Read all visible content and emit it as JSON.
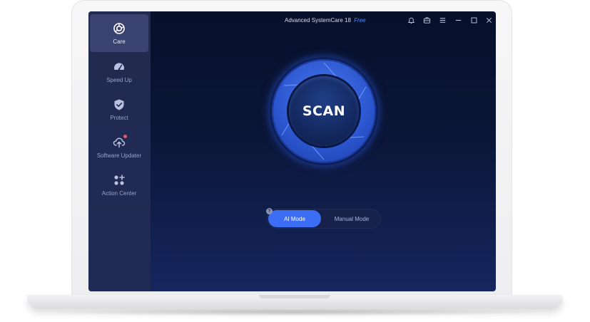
{
  "app": {
    "title": "Advanced SystemCare 18",
    "edition": "Free"
  },
  "sidebar": {
    "items": [
      {
        "label": "Care",
        "icon": "care-icon",
        "active": true
      },
      {
        "label": "Speed Up",
        "icon": "speedometer-icon",
        "active": false
      },
      {
        "label": "Protect",
        "icon": "shield-check-icon",
        "active": false
      },
      {
        "label": "Software Updater",
        "icon": "cloud-upload-icon",
        "active": false,
        "notification": true
      },
      {
        "label": "Action Center",
        "icon": "apps-grid-icon",
        "active": false
      }
    ]
  },
  "titlebar": {
    "icons": [
      "bell-icon",
      "toolbox-icon",
      "menu-icon",
      "minimize-icon",
      "maximize-icon",
      "close-icon"
    ]
  },
  "main": {
    "scan_label": "SCAN",
    "modes": [
      {
        "label": "AI Mode",
        "selected": true
      },
      {
        "label": "Manual Mode",
        "selected": false
      }
    ],
    "help_glyph": "?"
  },
  "colors": {
    "accent": "#3c6ef5",
    "edition": "#4b8cff",
    "notification": "#ff4d5e",
    "sidebar_bg": "#222a4f",
    "screen_bg": "#0b1638"
  }
}
